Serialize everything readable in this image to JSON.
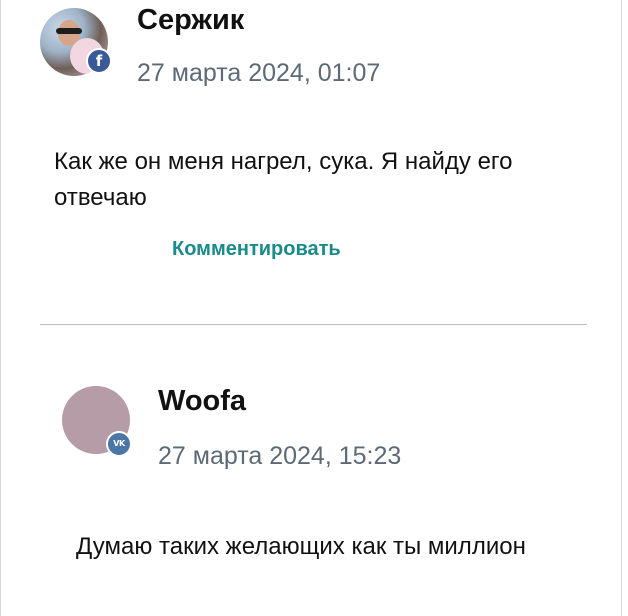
{
  "comments": [
    {
      "author": "Сержик",
      "network_icon": "facebook-icon",
      "network_label": "f",
      "date": "27 марта 2024, 01:07",
      "text": "Как же он меня нагрел, сука. Я найду его отвечаю",
      "action_label": "Комментировать"
    },
    {
      "author": "Woofa",
      "network_icon": "vk-icon",
      "network_label": "VK",
      "date": "27 марта 2024, 15:23",
      "text": "Думаю таких желающих как ты миллион"
    }
  ],
  "colors": {
    "action": "#1a8a8a",
    "date": "#5d6a76",
    "facebook": "#3b5998",
    "vk": "#4a76a8",
    "avatar_plain": "#b59ca7"
  }
}
